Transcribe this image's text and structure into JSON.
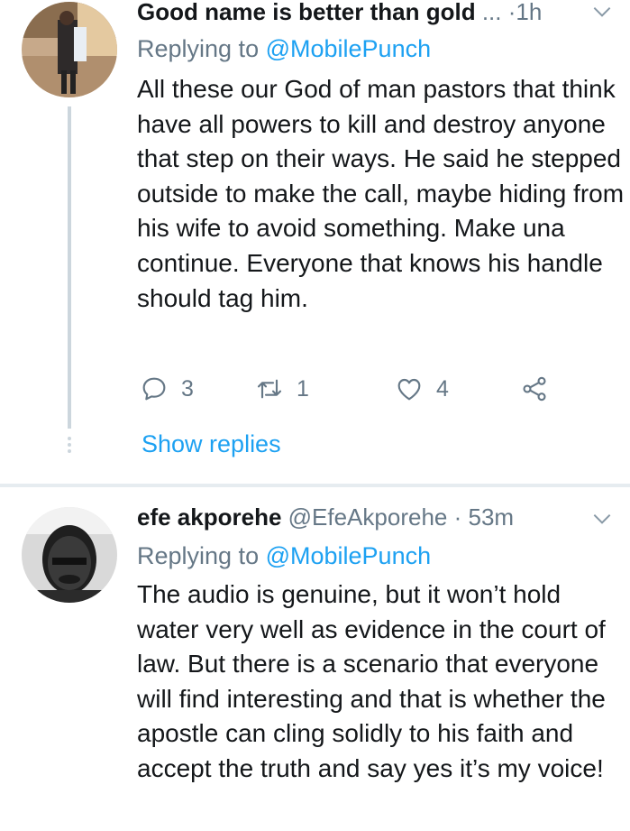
{
  "tweet1": {
    "name": "Good name is better than gold",
    "ellipsis": "...",
    "separator": "·",
    "time": "1h",
    "replying_prefix": "Replying to ",
    "replying_mention": "@MobilePunch",
    "text": "All these our God of man pastors that think have all powers to kill and destroy anyone that step on their ways. He said he stepped outside to make the call, maybe hiding from his wife to avoid something. Make una continue. Everyone that knows his handle should tag him.",
    "actions": {
      "replies": "3",
      "retweets": "1",
      "likes": "4"
    },
    "show_replies": "Show replies",
    "icons": {
      "reply": "reply-icon",
      "retweet": "retweet-icon",
      "like": "heart-icon",
      "share": "share-icon",
      "menu": "chevron-down-icon"
    }
  },
  "tweet2": {
    "name": "efe akporehe",
    "handle": "@EfeAkporehe",
    "separator": "·",
    "time": "53m",
    "replying_prefix": "Replying to ",
    "replying_mention": "@MobilePunch",
    "text": "The audio is genuine, but it won’t hold water very well as evidence in the court of law. But there is a scenario that everyone will find interesting and that is whether the apostle can cling solidly to his faith and accept the truth and say yes it’s my voice!",
    "icons": {
      "menu": "chevron-down-icon"
    }
  },
  "colors": {
    "link": "#1da1f2",
    "secondary": "#657786",
    "text": "#14171a",
    "line": "#ccd6dd"
  }
}
